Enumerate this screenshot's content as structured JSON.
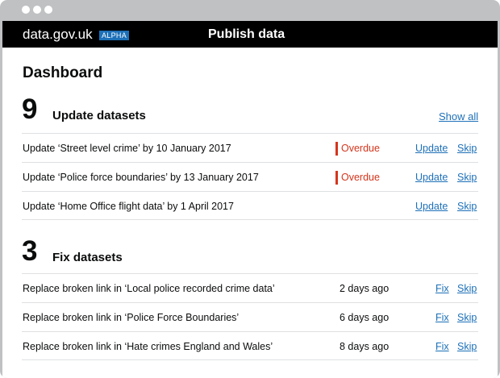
{
  "window": {
    "dots": [
      "",
      "",
      ""
    ]
  },
  "header": {
    "brand": "data.gov.uk",
    "phase_tag": "ALPHA",
    "service_name": "Publish data"
  },
  "page": {
    "title": "Dashboard"
  },
  "update_section": {
    "count": "9",
    "title": "Update datasets",
    "show_all_label": "Show all",
    "rows": [
      {
        "text": "Update ‘Street level crime’ by 10 January 2017",
        "status": "Overdue",
        "action1": "Update",
        "action2": "Skip"
      },
      {
        "text": "Update ‘Police force boundaries’ by 13 January 2017",
        "status": "Overdue",
        "action1": "Update",
        "action2": "Skip"
      },
      {
        "text": "Update ‘Home Office flight data’ by 1 April 2017",
        "status": "",
        "action1": "Update",
        "action2": "Skip"
      }
    ]
  },
  "fix_section": {
    "count": "3",
    "title": "Fix datasets",
    "rows": [
      {
        "text": "Replace broken link in ‘Local police recorded crime data’",
        "age": "2 days ago",
        "action1": "Fix",
        "action2": "Skip"
      },
      {
        "text": "Replace broken link in ‘Police Force Boundaries’",
        "age": "6 days ago",
        "action1": "Fix",
        "action2": "Skip"
      },
      {
        "text": "Replace broken link in ‘Hate crimes England and Wales’",
        "age": "8 days ago",
        "action1": "Fix",
        "action2": "Skip"
      }
    ]
  },
  "colors": {
    "header_bg": "#000000",
    "link": "#1d70b8",
    "overdue": "#d4351c",
    "phase_tag_bg": "#1d70b8",
    "frame": "#bfc1c3"
  }
}
